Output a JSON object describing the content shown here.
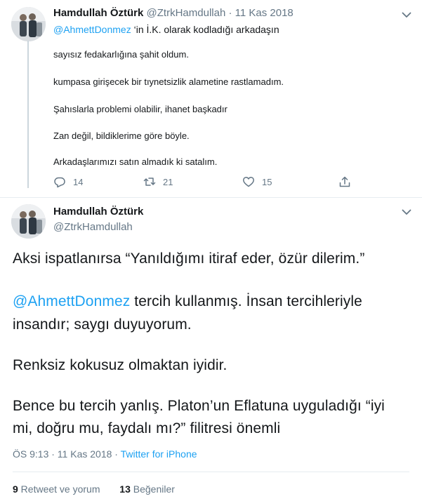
{
  "tweet1": {
    "name": "Hamdullah Öztürk",
    "handle": "@ZtrkHamdullah",
    "separator": "·",
    "time": "11 Kas 2018",
    "mention": "@AhmettDonmez",
    "reply_tail": " ‘in İ.K. olarak kodladığı arkadaşın",
    "lines": [
      "sayısız fedakarlığına şahit oldum.",
      "kumpasa girişecek bir tıynetsizlik alametine rastlamadım.",
      "Şahıslarla problemi olabilir, ihanet başkadır",
      "Zan değil, bildiklerime göre böyle.",
      "Arkadaşlarımızı satın almadık ki satalım."
    ],
    "reply_count": "14",
    "retweet_count": "21",
    "like_count": "15"
  },
  "tweet2": {
    "name": "Hamdullah Öztürk",
    "handle": "@ZtrkHamdullah",
    "line1": "Aksi ispatlanırsa “Yanıldığımı itiraf eder, özür dilerim.”",
    "mention": "@AhmettDonmez",
    "line2_tail": " tercih kullanmış. İnsan tercihleriyle",
    "line3": "insandır; saygı duyuyorum.",
    "line4": "Renksiz kokusuz olmaktan iyidir.",
    "line5": "Bence bu tercih yanlış. Platon’un Eflatuna uyguladığı “iyi",
    "line6": "mi, doğru mu, faydalı mı?” filitresi önemli",
    "timestamp": "ÖS 9:13 · 11 Kas 2018 · ",
    "source": "Twitter for iPhone",
    "retweet_count": "9",
    "retweet_label": " Retweet ve yorum",
    "like_count": "13",
    "like_label": " Beğeniler"
  },
  "colors": {
    "accent": "#1da1f2",
    "muted": "#657786",
    "text": "#14171a",
    "divider": "#e6ecf0"
  },
  "icons": [
    "reply-icon",
    "retweet-icon",
    "like-icon",
    "share-icon",
    "chevron-down-icon"
  ]
}
